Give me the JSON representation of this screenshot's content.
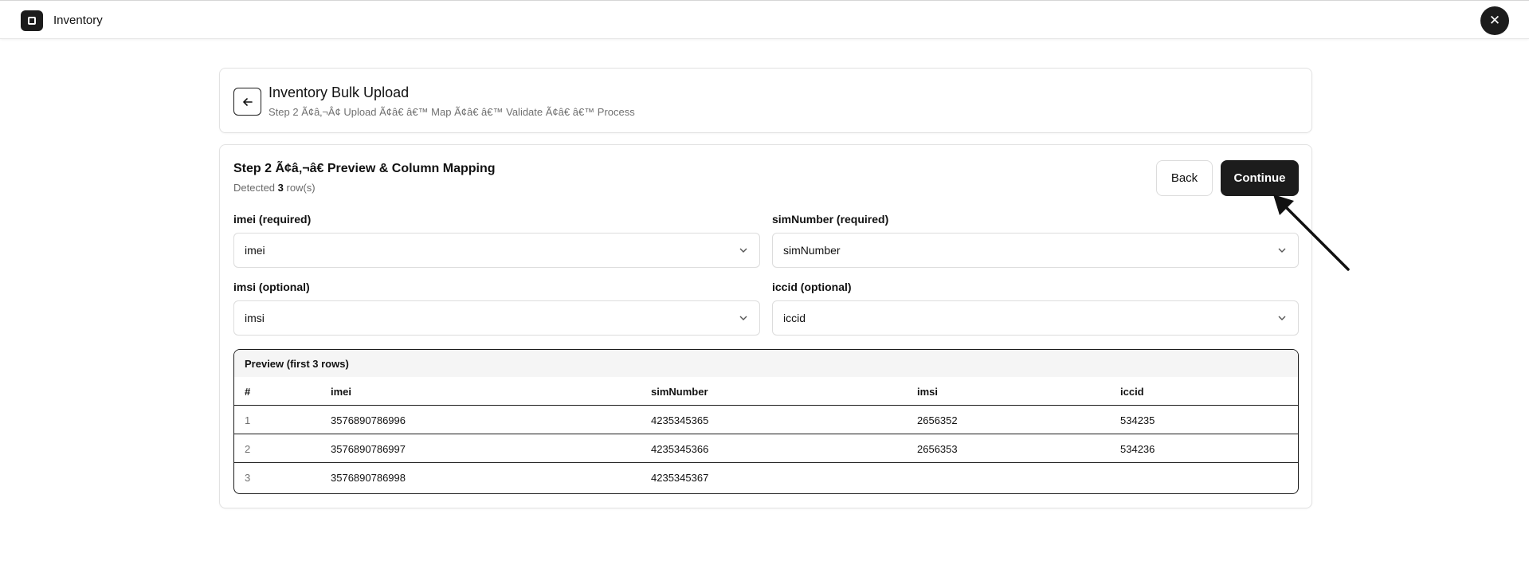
{
  "app": {
    "title": "Inventory",
    "logo_icon": "square-logo-icon",
    "close_icon": "close-icon"
  },
  "header": {
    "title": "Inventory Bulk Upload",
    "subtitle": "Step 2 Ã¢â‚¬Â¢ Upload Ã¢â€ â€™ Map Ã¢â€ â€™ Validate Ã¢â€ â€™ Process"
  },
  "step": {
    "title": "Step 2 Ã¢â‚¬â€ Preview & Column Mapping",
    "detected_prefix": "Detected",
    "detected_count": "3",
    "detected_suffix": "row(s)"
  },
  "buttons": {
    "back": "Back",
    "continue": "Continue"
  },
  "mapping": [
    {
      "label": "imei (required)",
      "value": "imei"
    },
    {
      "label": "simNumber (required)",
      "value": "simNumber"
    },
    {
      "label": "imsi (optional)",
      "value": "imsi"
    },
    {
      "label": "iccid (optional)",
      "value": "iccid"
    }
  ],
  "preview": {
    "title": "Preview (first 3 rows)",
    "columns": [
      "#",
      "imei",
      "simNumber",
      "imsi",
      "iccid"
    ],
    "rows": [
      [
        "1",
        "3576890786996",
        "4235345365",
        "2656352",
        "534235"
      ],
      [
        "2",
        "3576890786997",
        "4235345366",
        "2656353",
        "534236"
      ],
      [
        "3",
        "3576890786998",
        "4235345367",
        "",
        ""
      ]
    ]
  },
  "colors": {
    "primary": "#1c1c1c",
    "border": "#e2e2e2",
    "muted_text": "#707070"
  }
}
